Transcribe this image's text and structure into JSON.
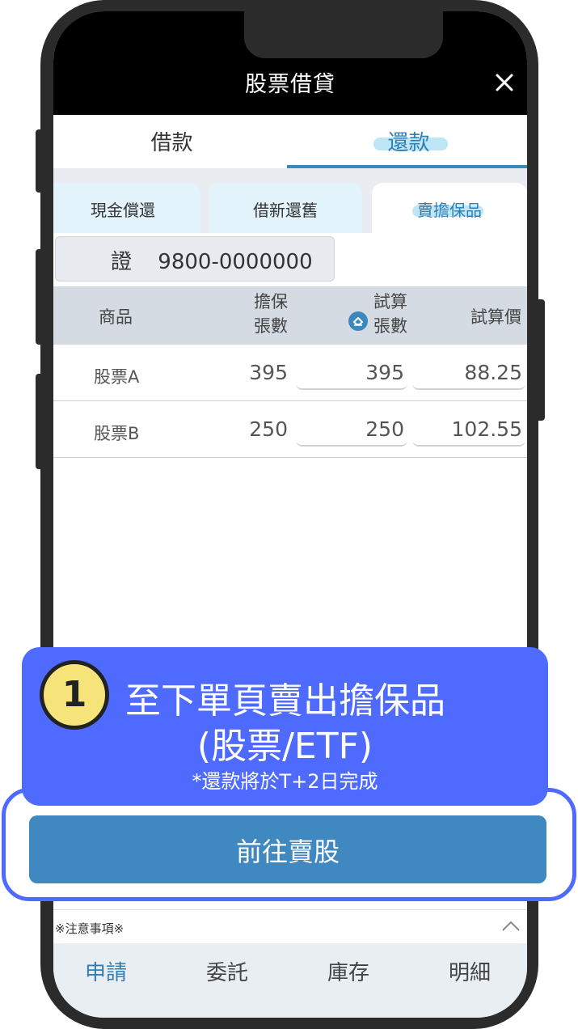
{
  "header": {
    "title": "股票借貸",
    "close_icon": "close-icon"
  },
  "main_tabs": [
    {
      "label": "借款",
      "active": false
    },
    {
      "label": "還款",
      "active": true
    }
  ],
  "sub_tabs": [
    {
      "label": "現金償還",
      "active": false
    },
    {
      "label": "借新還舊",
      "active": false
    },
    {
      "label": "賣擔保品",
      "active": true
    }
  ],
  "account": {
    "prefix": "證",
    "number": "9800-0000000"
  },
  "table": {
    "headers": {
      "product": "商品",
      "collateral_line1": "擔保",
      "collateral_line2": "張數",
      "trial_line1": "試算",
      "trial_line2": "張數",
      "trial_price": "試算價"
    },
    "rows": [
      {
        "name": "股票A",
        "collateral_qty": "395",
        "trial_qty": "395",
        "trial_price": "88.25"
      },
      {
        "name": "股票B",
        "collateral_qty": "250",
        "trial_qty": "250",
        "trial_price": "102.55"
      }
    ]
  },
  "tooltip": {
    "step": "1",
    "line1": "至下單頁賣出擔保品",
    "line2": "(股票/ETF)",
    "note": "*還款將於T+2日完成"
  },
  "cta": {
    "label": "前往賣股"
  },
  "notice": {
    "label": "※注意事項※"
  },
  "bottom_nav": [
    {
      "label": "申請",
      "active": true
    },
    {
      "label": "委託",
      "active": false
    },
    {
      "label": "庫存",
      "active": false
    },
    {
      "label": "明細",
      "active": false
    }
  ],
  "colors": {
    "accent": "#2f7fb5",
    "cta": "#3f88c0",
    "tooltip": "#4f6bff",
    "step_badge": "#f6e47a"
  }
}
